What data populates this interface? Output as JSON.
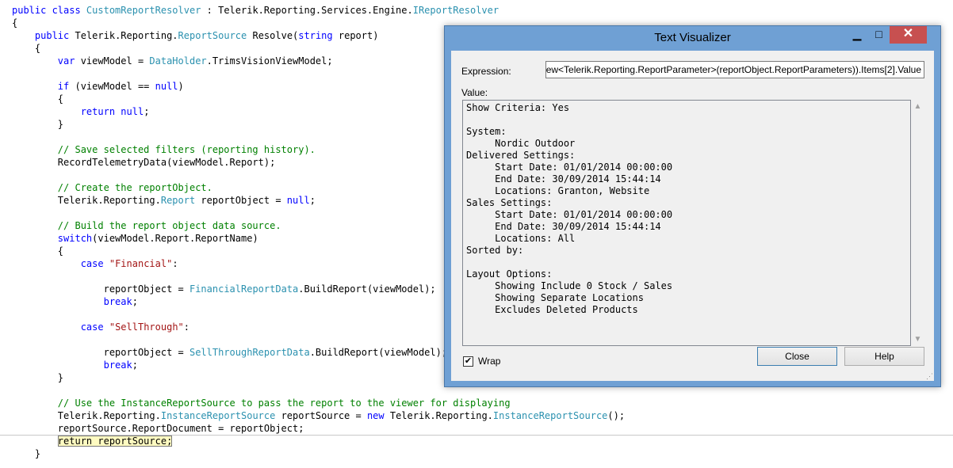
{
  "code": {
    "lines": [
      [
        {
          "c": "kw",
          "t": "public class "
        },
        {
          "c": "type",
          "t": "CustomReportResolver"
        },
        {
          "c": "plain",
          "t": " : Telerik.Reporting.Services.Engine."
        },
        {
          "c": "type",
          "t": "IReportResolver"
        }
      ],
      [
        {
          "c": "plain",
          "t": "{"
        }
      ],
      [
        {
          "c": "plain",
          "t": "    "
        },
        {
          "c": "kw",
          "t": "public"
        },
        {
          "c": "plain",
          "t": " Telerik.Reporting."
        },
        {
          "c": "type",
          "t": "ReportSource"
        },
        {
          "c": "plain",
          "t": " Resolve("
        },
        {
          "c": "kw",
          "t": "string"
        },
        {
          "c": "plain",
          "t": " report)"
        }
      ],
      [
        {
          "c": "plain",
          "t": "    {"
        }
      ],
      [
        {
          "c": "plain",
          "t": "        "
        },
        {
          "c": "kw",
          "t": "var"
        },
        {
          "c": "plain",
          "t": " viewModel = "
        },
        {
          "c": "type",
          "t": "DataHolder"
        },
        {
          "c": "plain",
          "t": ".TrimsVisionViewModel;"
        }
      ],
      [],
      [
        {
          "c": "plain",
          "t": "        "
        },
        {
          "c": "kw",
          "t": "if"
        },
        {
          "c": "plain",
          "t": " (viewModel == "
        },
        {
          "c": "kw",
          "t": "null"
        },
        {
          "c": "plain",
          "t": ")"
        }
      ],
      [
        {
          "c": "plain",
          "t": "        {"
        }
      ],
      [
        {
          "c": "plain",
          "t": "            "
        },
        {
          "c": "kw",
          "t": "return null"
        },
        {
          "c": "plain",
          "t": ";"
        }
      ],
      [
        {
          "c": "plain",
          "t": "        }"
        }
      ],
      [],
      [
        {
          "c": "plain",
          "t": "        "
        },
        {
          "c": "com",
          "t": "// Save selected filters (reporting history)."
        }
      ],
      [
        {
          "c": "plain",
          "t": "        RecordTelemetryData(viewModel.Report);"
        }
      ],
      [],
      [
        {
          "c": "plain",
          "t": "        "
        },
        {
          "c": "com",
          "t": "// Create the reportObject."
        }
      ],
      [
        {
          "c": "plain",
          "t": "        Telerik.Reporting."
        },
        {
          "c": "type",
          "t": "Report"
        },
        {
          "c": "plain",
          "t": " reportObject = "
        },
        {
          "c": "kw",
          "t": "null"
        },
        {
          "c": "plain",
          "t": ";"
        }
      ],
      [],
      [
        {
          "c": "plain",
          "t": "        "
        },
        {
          "c": "com",
          "t": "// Build the report object data source."
        }
      ],
      [
        {
          "c": "plain",
          "t": "        "
        },
        {
          "c": "kw",
          "t": "switch"
        },
        {
          "c": "plain",
          "t": "(viewModel.Report.ReportName)"
        }
      ],
      [
        {
          "c": "plain",
          "t": "        {"
        }
      ],
      [
        {
          "c": "plain",
          "t": "            "
        },
        {
          "c": "kw",
          "t": "case"
        },
        {
          "c": "plain",
          "t": " "
        },
        {
          "c": "str",
          "t": "\"Financial\""
        },
        {
          "c": "plain",
          "t": ":"
        }
      ],
      [],
      [
        {
          "c": "plain",
          "t": "                reportObject = "
        },
        {
          "c": "type",
          "t": "FinancialReportData"
        },
        {
          "c": "plain",
          "t": ".BuildReport(viewModel);"
        }
      ],
      [
        {
          "c": "plain",
          "t": "                "
        },
        {
          "c": "kw",
          "t": "break"
        },
        {
          "c": "plain",
          "t": ";"
        }
      ],
      [],
      [
        {
          "c": "plain",
          "t": "            "
        },
        {
          "c": "kw",
          "t": "case"
        },
        {
          "c": "plain",
          "t": " "
        },
        {
          "c": "str",
          "t": "\"SellThrough\""
        },
        {
          "c": "plain",
          "t": ":"
        }
      ],
      [],
      [
        {
          "c": "plain",
          "t": "                reportObject = "
        },
        {
          "c": "type",
          "t": "SellThroughReportData"
        },
        {
          "c": "plain",
          "t": ".BuildReport(viewModel);"
        }
      ],
      [
        {
          "c": "plain",
          "t": "                "
        },
        {
          "c": "kw",
          "t": "break"
        },
        {
          "c": "plain",
          "t": ";"
        }
      ],
      [
        {
          "c": "plain",
          "t": "        }"
        }
      ],
      [],
      [
        {
          "c": "plain",
          "t": "        "
        },
        {
          "c": "com",
          "t": "// Use the InstanceReportSource to pass the report to the viewer for displaying"
        }
      ],
      [
        {
          "c": "plain",
          "t": "        Telerik.Reporting."
        },
        {
          "c": "type",
          "t": "InstanceReportSource"
        },
        {
          "c": "plain",
          "t": " reportSource = "
        },
        {
          "c": "kw",
          "t": "new"
        },
        {
          "c": "plain",
          "t": " Telerik.Reporting."
        },
        {
          "c": "type",
          "t": "InstanceReportSource"
        },
        {
          "c": "plain",
          "t": "();"
        }
      ],
      [
        {
          "c": "plain",
          "t": "        reportSource.ReportDocument = reportObject;"
        }
      ],
      [
        {
          "c": "plain",
          "t": "        "
        },
        {
          "c": "hl",
          "t": "return reportSource;"
        }
      ],
      [
        {
          "c": "plain",
          "t": "    }"
        }
      ]
    ]
  },
  "dialog": {
    "title": "Text Visualizer",
    "minimize_glyph": "▁",
    "maximize_glyph": "□",
    "close_glyph": "✕",
    "expression_label": "Expression:",
    "expression_value": "ew<Telerik.Reporting.ReportParameter>(reportObject.ReportParameters)).Items[2].Value",
    "value_label": "Value:",
    "value_text": "Show Criteria: Yes\n\nSystem:\n     Nordic Outdoor\nDelivered Settings:\n     Start Date: 01/01/2014 00:00:00\n     End Date: 30/09/2014 15:44:14\n     Locations: Granton, Website\nSales Settings:\n     Start Date: 01/01/2014 00:00:00\n     End Date: 30/09/2014 15:44:14\n     Locations: All\nSorted by:\n\nLayout Options:\n     Showing Include 0 Stock / Sales\n     Showing Separate Locations\n     Excludes Deleted Products",
    "wrap_label": "Wrap",
    "wrap_checked": true,
    "check_glyph": "✔",
    "close_button": "Close",
    "help_button": "Help",
    "scroll_up_glyph": "▲",
    "scroll_down_glyph": "▼",
    "resize_glyph": "⋰"
  }
}
